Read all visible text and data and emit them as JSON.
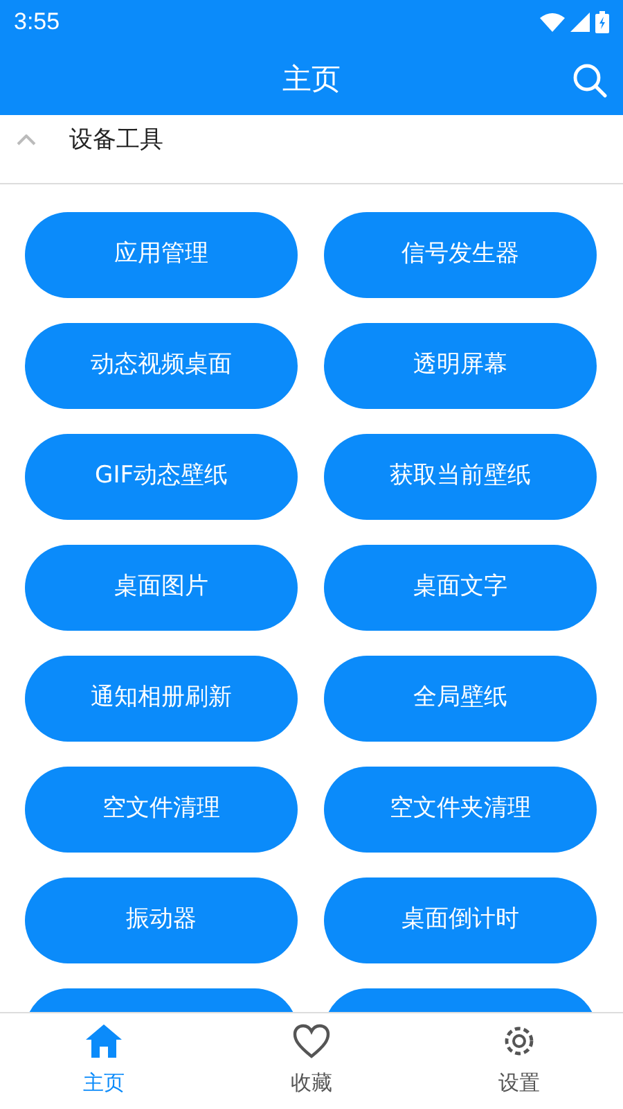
{
  "status_bar": {
    "time": "3:55"
  },
  "app_bar": {
    "title": "主页"
  },
  "section": {
    "title": "设备工具",
    "expanded": true
  },
  "tools": [
    {
      "label": "应用管理"
    },
    {
      "label": "信号发生器"
    },
    {
      "label": "动态视频桌面"
    },
    {
      "label": "透明屏幕"
    },
    {
      "label": "GIF动态壁纸"
    },
    {
      "label": "获取当前壁纸"
    },
    {
      "label": "桌面图片"
    },
    {
      "label": "桌面文字"
    },
    {
      "label": "通知相册刷新"
    },
    {
      "label": "全局壁纸"
    },
    {
      "label": "空文件清理"
    },
    {
      "label": "空文件夹清理"
    },
    {
      "label": "振动器"
    },
    {
      "label": "桌面倒计时"
    }
  ],
  "cut_off_buttons": [
    {
      "kind": "button"
    },
    {
      "kind": "button"
    }
  ],
  "bottom_nav": [
    {
      "label": "主页",
      "kind": "home",
      "selected": true
    },
    {
      "label": "收藏",
      "kind": "favorite",
      "selected": false
    },
    {
      "label": "设置",
      "kind": "settings",
      "selected": false
    }
  ]
}
